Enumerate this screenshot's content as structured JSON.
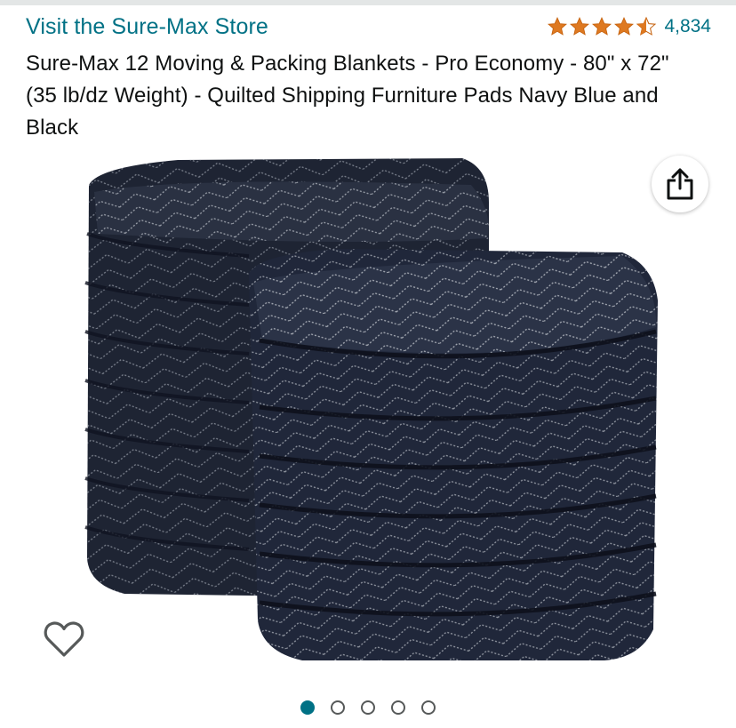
{
  "store": {
    "link_text": "Visit the Sure-Max Store"
  },
  "rating": {
    "stars": 4.5,
    "count": "4,834",
    "star_color": "#de7921"
  },
  "product": {
    "title": "Sure-Max 12 Moving & Packing Blankets - Pro Economy - 80\" x 72\" (35 lb/dz Weight) - Quilted Shipping Furniture Pads Navy Blue and Black"
  },
  "image": {
    "subject": "stack of navy quilted moving blankets",
    "blanket_color": "#252b3b",
    "stitch_color": "#a8adb6"
  },
  "actions": {
    "share_icon": "share-icon",
    "wishlist_icon": "heart-icon"
  },
  "carousel": {
    "total": 5,
    "active": 1
  },
  "colors": {
    "link": "#007185",
    "text": "#0f1111"
  }
}
